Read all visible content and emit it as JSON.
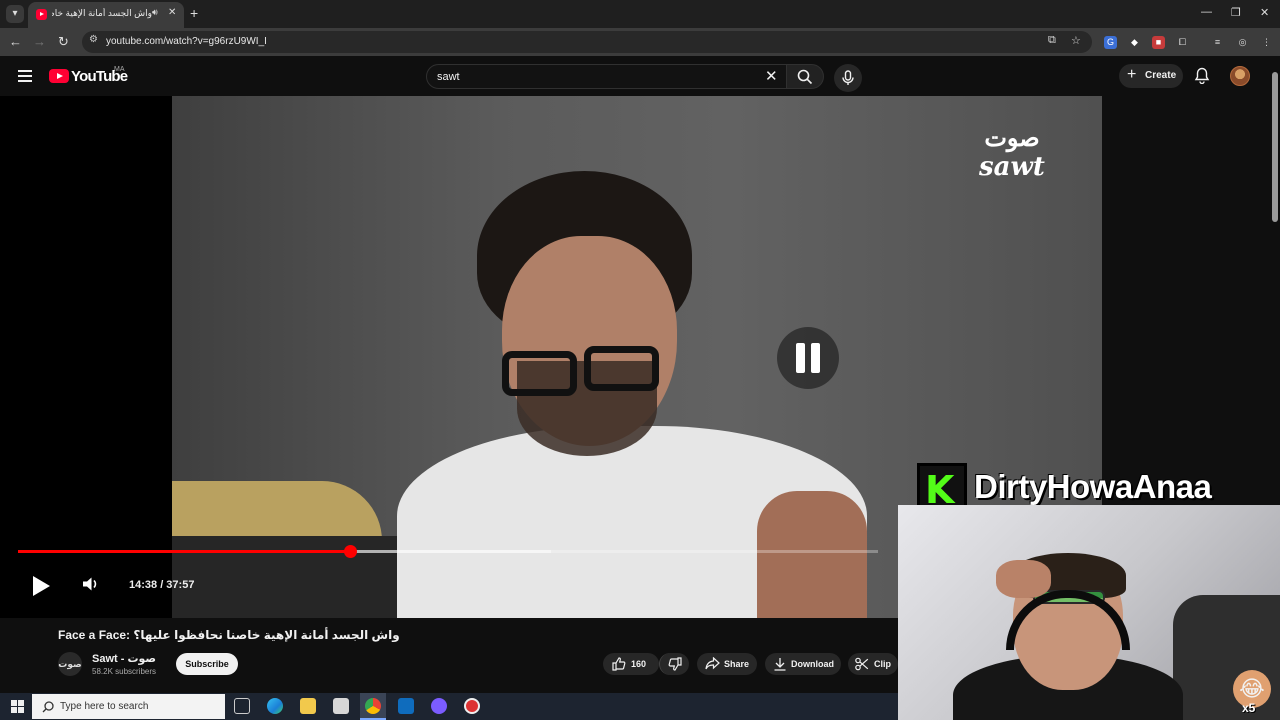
{
  "browser": {
    "tab_title": "واش الجسد أمانة الإهية خاصنا",
    "new_tab": "+",
    "url": "youtube.com/watch?v=g96rzU9WI_I"
  },
  "youtube": {
    "logo_text": "YouTube",
    "country_code": "MA",
    "search_value": "sawt",
    "create_label": "Create"
  },
  "video": {
    "channel_watermark_arabic": "صوت",
    "channel_watermark_latin": "sawt",
    "time_display": "14:38 / 37:57",
    "progress_fraction": 0.386,
    "buffer_fraction": 0.62,
    "title": "Face a Face: واش الجسد أمانة الإهية خاصنا نحافظوا عليها؟",
    "channel_name": "Sawt - صوت",
    "channel_avatar_text": "صوت",
    "subscribers": "58.2K subscribers",
    "subscribe_label": "Subscribe",
    "likes": "160",
    "share_label": "Share",
    "download_label": "Download",
    "clip_label": "Clip"
  },
  "overlay": {
    "kick_logo": "K",
    "streamer_name": "DirtyHowaAnaa",
    "emote_count": "x5"
  },
  "taskbar": {
    "search_placeholder": "Type here to search"
  },
  "colors": {
    "youtube_red": "#ff0033",
    "progress_red": "#ff0000",
    "kick_green": "#53fc18",
    "background": "#0f0f0f"
  },
  "icons": {
    "tab_search": "chevron-down-icon",
    "back": "arrow-left-icon",
    "forward": "arrow-right-icon",
    "reload": "reload-icon",
    "search": "search-icon",
    "mic": "mic-icon",
    "bell": "bell-icon",
    "like": "thumbs-up-icon",
    "dislike": "thumbs-down-icon",
    "share": "share-icon",
    "download": "download-icon",
    "clip": "scissors-icon"
  }
}
